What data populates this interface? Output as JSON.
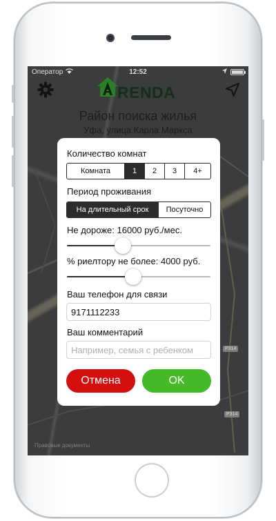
{
  "status": {
    "carrier": "Оператор",
    "time": "12:52"
  },
  "header": {
    "logo_letter": "A",
    "logo_rest": "RENDA"
  },
  "map": {
    "title": "Район поиска жилья",
    "address": "Уфа, улица Карла Маркса",
    "road_badges": [
      "P314",
      "P314",
      "P314"
    ],
    "legal": "Правовые документы"
  },
  "dialog": {
    "rooms_label": "Количество комнат",
    "rooms_options": [
      "Комната",
      "1",
      "2",
      "3",
      "4+"
    ],
    "rooms_selected": "1",
    "period_label": "Период проживания",
    "period_options": [
      "На длительный срок",
      "Посуточно"
    ],
    "period_selected": "На длительный срок",
    "price_label": "Не дороже: 16000 руб./мес.",
    "price_slider_fraction": 0.39,
    "realtor_label": "% риелтору не более: 4000 руб.",
    "realtor_slider_fraction": 0.46,
    "phone_label": "Ваш телефон для связи",
    "phone_value": "9171112233",
    "comment_label": "Ваш комментарий",
    "comment_placeholder": "Например, семья с ребенком",
    "cancel_label": "Отмена",
    "ok_label": "OK"
  },
  "colors": {
    "cancel": "#d40f0f",
    "ok": "#45b928",
    "segment_active": "#2c2c2c",
    "logo": "#17321c"
  }
}
